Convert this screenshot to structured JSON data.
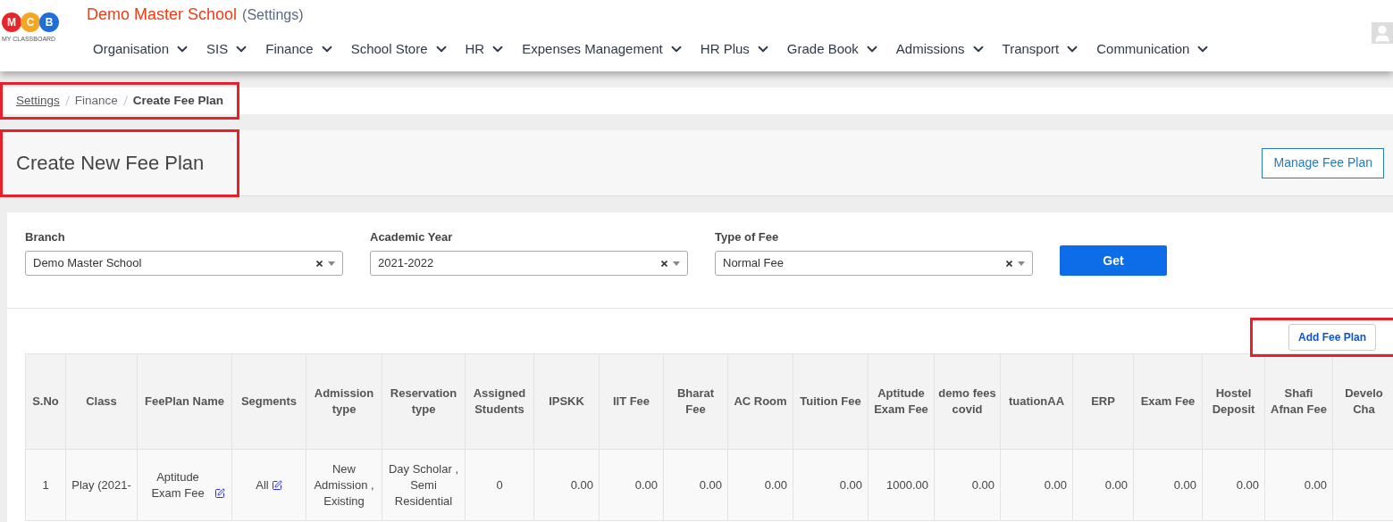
{
  "header": {
    "school_name": "Demo Master School",
    "subtitle": "(Settings)",
    "logo_letters": [
      "M",
      "C",
      "B"
    ],
    "logo_caption": "MY CLASSBOARD"
  },
  "nav": [
    {
      "label": "Organisation"
    },
    {
      "label": "SIS"
    },
    {
      "label": "Finance"
    },
    {
      "label": "School Store"
    },
    {
      "label": "HR"
    },
    {
      "label": "Expenses Management"
    },
    {
      "label": "HR Plus"
    },
    {
      "label": "Grade Book"
    },
    {
      "label": "Admissions"
    },
    {
      "label": "Transport"
    },
    {
      "label": "Communication"
    }
  ],
  "breadcrumb": [
    {
      "label": "Settings",
      "kind": "link"
    },
    {
      "label": "Finance",
      "kind": "plain"
    },
    {
      "label": "Create Fee Plan",
      "kind": "current"
    }
  ],
  "page_title": "Create New Fee Plan",
  "manage_button": "Manage Fee Plan",
  "filters": [
    {
      "label": "Branch",
      "value": "Demo Master School"
    },
    {
      "label": "Academic Year",
      "value": "2021-2022"
    },
    {
      "label": "Type of Fee",
      "value": "Normal Fee"
    }
  ],
  "get_button": "Get",
  "add_button": "Add Fee Plan",
  "table": {
    "columns": [
      "S.No",
      "Class",
      "FeePlan Name",
      "Segments",
      "Admission type",
      "Reservation type",
      "Assigned Students",
      "IPSKK",
      "IIT Fee",
      "Bharat Fee",
      "AC Room",
      "Tuition Fee",
      "Aptitude Exam Fee",
      "demo fees covid",
      "tuationAA",
      "ERP",
      "Exam Fee",
      "Hostel Deposit",
      "Shafi Afnan Fee",
      "Develo Cha"
    ],
    "rows": [
      {
        "cells": [
          {
            "kind": "text",
            "text": "1"
          },
          {
            "kind": "text",
            "text": "Play (2021-"
          },
          {
            "kind": "editable",
            "text": "Aptitude Exam Fee"
          },
          {
            "kind": "editable",
            "text": "All"
          },
          {
            "kind": "text",
            "text": "New Admission , Existing"
          },
          {
            "kind": "text",
            "text": "Day Scholar , Semi Residential"
          },
          {
            "kind": "text",
            "text": "0"
          },
          {
            "kind": "number",
            "text": "0.00"
          },
          {
            "kind": "number",
            "text": "0.00"
          },
          {
            "kind": "number",
            "text": "0.00"
          },
          {
            "kind": "number",
            "text": "0.00"
          },
          {
            "kind": "number",
            "text": "0.00"
          },
          {
            "kind": "number",
            "text": "1000.00"
          },
          {
            "kind": "number",
            "text": "0.00"
          },
          {
            "kind": "number",
            "text": "0.00"
          },
          {
            "kind": "number",
            "text": "0.00"
          },
          {
            "kind": "number",
            "text": "0.00"
          },
          {
            "kind": "number",
            "text": "0.00"
          },
          {
            "kind": "number",
            "text": "0.00"
          }
        ]
      }
    ]
  }
}
